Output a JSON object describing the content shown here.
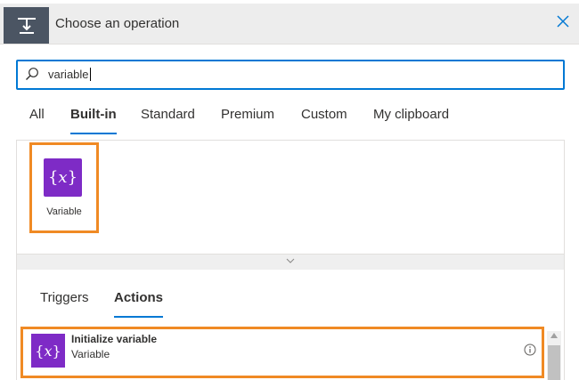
{
  "header": {
    "title": "Choose an operation",
    "icon": "trigger-step-icon",
    "close_icon": "close-icon"
  },
  "search": {
    "value": "variable",
    "icon": "search-icon"
  },
  "tabs": [
    {
      "label": "All",
      "active": false
    },
    {
      "label": "Built-in",
      "active": true
    },
    {
      "label": "Standard",
      "active": false
    },
    {
      "label": "Premium",
      "active": false
    },
    {
      "label": "Custom",
      "active": false
    },
    {
      "label": "My clipboard",
      "active": false
    }
  ],
  "connectors": [
    {
      "label": "Variable",
      "icon": "variable-icon",
      "highlighted": true
    }
  ],
  "subtabs": [
    {
      "label": "Triggers",
      "active": false
    },
    {
      "label": "Actions",
      "active": true
    }
  ],
  "actions": [
    {
      "name": "Initialize variable",
      "connector": "Variable",
      "icon": "variable-icon",
      "info_icon": "info-icon",
      "highlighted": true
    }
  ],
  "colors": {
    "accent": "#0078d4",
    "highlight": "#f08a24",
    "variable_tile": "#7e2bc6",
    "header_bg": "#ededed",
    "header_icon_bg": "#4b5563"
  }
}
